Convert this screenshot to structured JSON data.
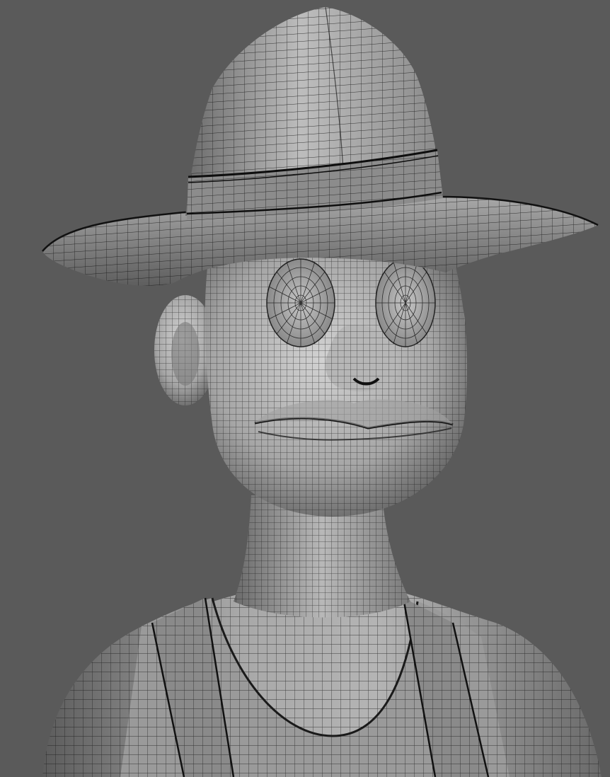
{
  "viewport": {
    "background_color": "#5a5a5a",
    "shading_mode": "wireframe-on-shaded",
    "wire_color": "#141414",
    "surface_light": "#c8c8c8",
    "surface_mid": "#8e8e8e",
    "surface_dark": "#3c3c3c"
  },
  "subject": {
    "parts": [
      "fedora-hat",
      "hat-band",
      "hat-brim",
      "head",
      "left-ear",
      "right-ear",
      "left-eye",
      "right-eye",
      "nose",
      "mouth",
      "neck",
      "shoulders",
      "tank-top",
      "left-strap",
      "right-strap"
    ]
  }
}
